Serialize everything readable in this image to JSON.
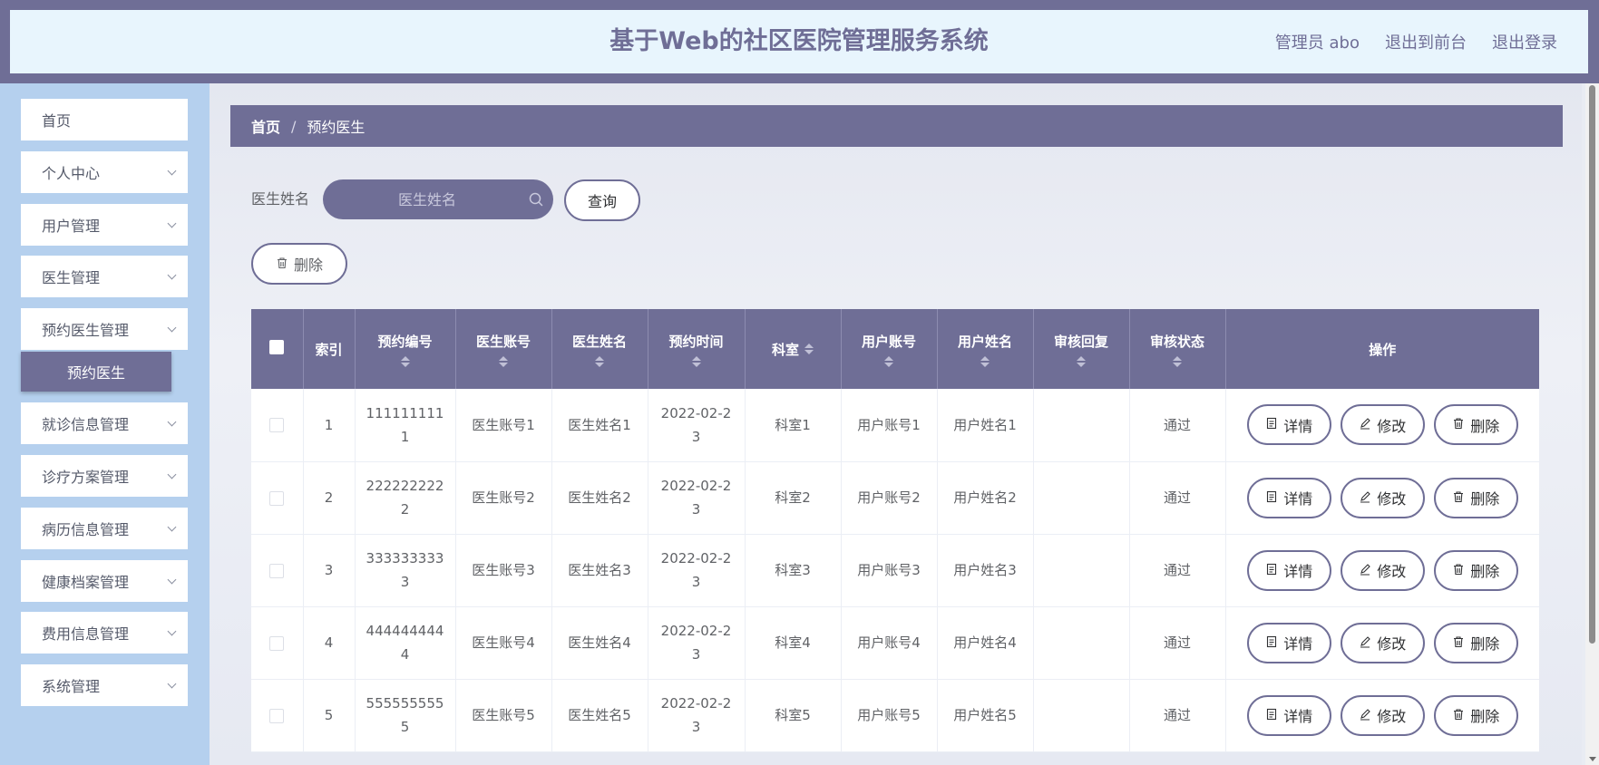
{
  "header": {
    "title": "基于Web的社区医院管理服务系统",
    "admin_label": "管理员 abo",
    "to_front_label": "退出到前台",
    "logout_label": "退出登录"
  },
  "sidebar": {
    "items": [
      {
        "label": "首页"
      },
      {
        "label": "个人中心"
      },
      {
        "label": "用户管理"
      },
      {
        "label": "医生管理"
      },
      {
        "label": "预约医生管理"
      },
      {
        "label": "就诊信息管理"
      },
      {
        "label": "诊疗方案管理"
      },
      {
        "label": "病历信息管理"
      },
      {
        "label": "健康档案管理"
      },
      {
        "label": "费用信息管理"
      },
      {
        "label": "系统管理"
      }
    ],
    "active_sub": "预约医生"
  },
  "breadcrumb": {
    "home": "首页",
    "separator": "/",
    "current": "预约医生"
  },
  "search": {
    "label": "医生姓名",
    "placeholder": "医生姓名",
    "query_button": "查询"
  },
  "bulk_delete_label": "删除",
  "table": {
    "headers": {
      "index": "索引",
      "appt_no": "预约编号",
      "doctor_account": "医生账号",
      "doctor_name": "医生姓名",
      "appt_time": "预约时间",
      "department": "科室",
      "user_account": "用户账号",
      "user_name": "用户姓名",
      "review_reply": "审核回复",
      "review_status": "审核状态",
      "actions": "操作"
    },
    "rows": [
      {
        "index": "1",
        "appt_no_a": "111111111",
        "appt_no_b": "1",
        "doctor_account": "医生账号1",
        "doctor_name": "医生姓名1",
        "time_a": "2022-02-2",
        "time_b": "3",
        "department": "科室1",
        "user_account": "用户账号1",
        "user_name": "用户姓名1",
        "review_reply": "",
        "review_status": "通过"
      },
      {
        "index": "2",
        "appt_no_a": "222222222",
        "appt_no_b": "2",
        "doctor_account": "医生账号2",
        "doctor_name": "医生姓名2",
        "time_a": "2022-02-2",
        "time_b": "3",
        "department": "科室2",
        "user_account": "用户账号2",
        "user_name": "用户姓名2",
        "review_reply": "",
        "review_status": "通过"
      },
      {
        "index": "3",
        "appt_no_a": "333333333",
        "appt_no_b": "3",
        "doctor_account": "医生账号3",
        "doctor_name": "医生姓名3",
        "time_a": "2022-02-2",
        "time_b": "3",
        "department": "科室3",
        "user_account": "用户账号3",
        "user_name": "用户姓名3",
        "review_reply": "",
        "review_status": "通过"
      },
      {
        "index": "4",
        "appt_no_a": "444444444",
        "appt_no_b": "4",
        "doctor_account": "医生账号4",
        "doctor_name": "医生姓名4",
        "time_a": "2022-02-2",
        "time_b": "3",
        "department": "科室4",
        "user_account": "用户账号4",
        "user_name": "用户姓名4",
        "review_reply": "",
        "review_status": "通过"
      },
      {
        "index": "5",
        "appt_no_a": "555555555",
        "appt_no_b": "5",
        "doctor_account": "医生账号5",
        "doctor_name": "医生姓名5",
        "time_a": "2022-02-2",
        "time_b": "3",
        "department": "科室5",
        "user_account": "用户账号5",
        "user_name": "用户姓名5",
        "review_reply": "",
        "review_status": "通过"
      }
    ],
    "actions": {
      "detail": "详情",
      "edit": "修改",
      "delete": "删除"
    }
  },
  "colors": {
    "primary": "#6f6e96",
    "header_bg": "#e8f5fd",
    "sidebar_bg": "#b5d0ee"
  }
}
